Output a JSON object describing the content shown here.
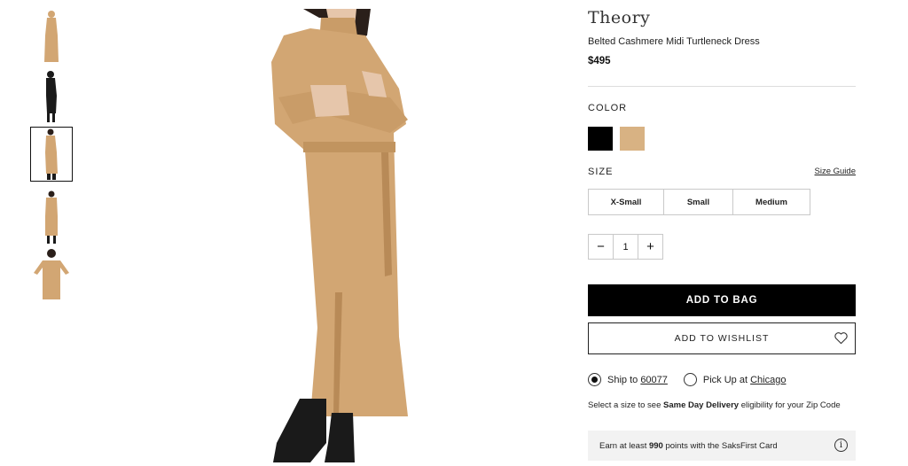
{
  "product": {
    "brand": "Theory",
    "name": "Belted Cashmere Midi Turtleneck Dress",
    "price": "$495"
  },
  "gallery": {
    "active_index": 2,
    "thumbnail_count": 5
  },
  "color": {
    "label": "COLOR",
    "swatches": [
      {
        "name": "black",
        "hex": "#000000"
      },
      {
        "name": "camel",
        "hex": "#d8b283"
      }
    ]
  },
  "size": {
    "label": "SIZE",
    "guide_link": "Size Guide",
    "options": [
      "X-Small",
      "Small",
      "Medium"
    ]
  },
  "quantity": {
    "value": "1",
    "minus": "−",
    "plus": "+"
  },
  "actions": {
    "add_to_bag": "ADD TO BAG",
    "add_to_wishlist": "ADD TO WISHLIST"
  },
  "shipping": {
    "ship_to_label": "Ship to",
    "ship_to_zip": "60077",
    "pickup_label": "Pick Up at",
    "pickup_store": "Chicago",
    "selected": "ship",
    "note_prefix": "Select a size to see",
    "note_bold": "Same Day Delivery",
    "note_suffix": "eligibility for your Zip Code"
  },
  "rewards": {
    "prefix": "Earn at least",
    "points": "990",
    "suffix": "points with the SaksFirst Card",
    "info_icon": "i"
  },
  "colors": {
    "dress": "#d2a673",
    "dress_shadow": "#b88a57",
    "boots": "#1a1a1a",
    "hair": "#2a1f1a",
    "skin": "#e6c6ab"
  }
}
